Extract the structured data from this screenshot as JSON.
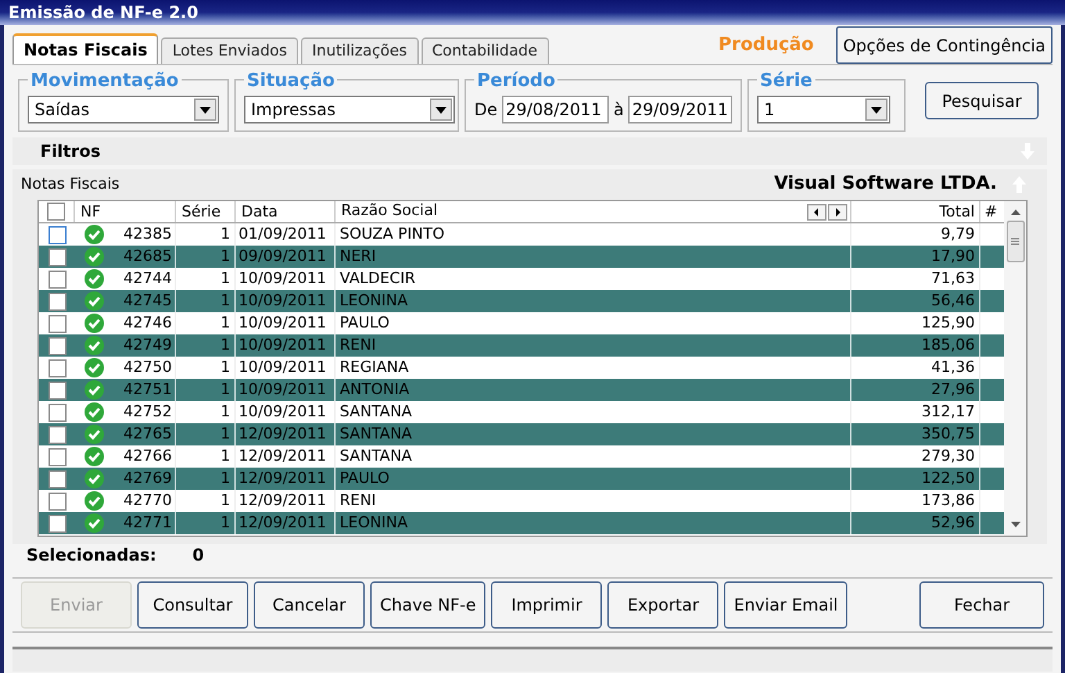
{
  "window": {
    "title": "Emissão de NF-e 2.0"
  },
  "tabs": [
    {
      "label": "Notas Fiscais",
      "selected": true
    },
    {
      "label": "Lotes Enviados",
      "selected": false
    },
    {
      "label": "Inutilizações",
      "selected": false
    },
    {
      "label": "Contabilidade",
      "selected": false
    }
  ],
  "environment": "Produção",
  "contingency_button": "Opções de Contingência",
  "filters": {
    "movimentacao": {
      "label": "Movimentação",
      "value": "Saídas"
    },
    "situacao": {
      "label": "Situação",
      "value": "Impressas"
    },
    "periodo": {
      "label": "Período",
      "from_prefix": "De",
      "from": "29/08/2011",
      "to_prefix": "à",
      "to": "29/09/2011"
    },
    "serie": {
      "label": "Série",
      "value": "1"
    },
    "search_button": "Pesquisar"
  },
  "filters_bar": {
    "title": "Filtros"
  },
  "grid": {
    "title": "Notas Fiscais",
    "company": "Visual Software LTDA.",
    "select_all_checked": false,
    "columns": [
      "NF",
      "Série",
      "Data",
      "Razão Social",
      "Total",
      "#"
    ],
    "rows": [
      {
        "nf": "42385",
        "serie": "1",
        "data": "01/09/2011",
        "razao": "SOUZA PINTO",
        "total": "9,79",
        "checked": false,
        "selected": false
      },
      {
        "nf": "42685",
        "serie": "1",
        "data": "09/09/2011",
        "razao": "NERI",
        "total": "17,90",
        "checked": false,
        "selected": true
      },
      {
        "nf": "42744",
        "serie": "1",
        "data": "10/09/2011",
        "razao": "VALDECIR",
        "total": "71,63",
        "checked": false,
        "selected": false
      },
      {
        "nf": "42745",
        "serie": "1",
        "data": "10/09/2011",
        "razao": "LEONINA",
        "total": "56,46",
        "checked": false,
        "selected": true
      },
      {
        "nf": "42746",
        "serie": "1",
        "data": "10/09/2011",
        "razao": "PAULO",
        "total": "125,90",
        "checked": false,
        "selected": false
      },
      {
        "nf": "42749",
        "serie": "1",
        "data": "10/09/2011",
        "razao": "RENI",
        "total": "185,06",
        "checked": false,
        "selected": true
      },
      {
        "nf": "42750",
        "serie": "1",
        "data": "10/09/2011",
        "razao": "REGIANA",
        "total": "41,36",
        "checked": false,
        "selected": false
      },
      {
        "nf": "42751",
        "serie": "1",
        "data": "10/09/2011",
        "razao": "ANTONIA",
        "total": "27,96",
        "checked": false,
        "selected": true
      },
      {
        "nf": "42752",
        "serie": "1",
        "data": "10/09/2011",
        "razao": "SANTANA",
        "total": "312,17",
        "checked": false,
        "selected": false
      },
      {
        "nf": "42765",
        "serie": "1",
        "data": "12/09/2011",
        "razao": "SANTANA",
        "total": "350,75",
        "checked": false,
        "selected": true
      },
      {
        "nf": "42766",
        "serie": "1",
        "data": "12/09/2011",
        "razao": "SANTANA",
        "total": "279,30",
        "checked": false,
        "selected": false
      },
      {
        "nf": "42769",
        "serie": "1",
        "data": "12/09/2011",
        "razao": "PAULO",
        "total": "122,50",
        "checked": false,
        "selected": true
      },
      {
        "nf": "42770",
        "serie": "1",
        "data": "12/09/2011",
        "razao": "RENI",
        "total": "173,86",
        "checked": false,
        "selected": false
      },
      {
        "nf": "42771",
        "serie": "1",
        "data": "12/09/2011",
        "razao": "LEONINA",
        "total": "52,96",
        "checked": false,
        "selected": true
      }
    ]
  },
  "selected_count": {
    "label": "Selecionadas:",
    "value": "0"
  },
  "buttons": [
    {
      "label": "Enviar",
      "disabled": true
    },
    {
      "label": "Consultar",
      "disabled": false
    },
    {
      "label": "Cancelar",
      "disabled": false
    },
    {
      "label": "Chave NF-e",
      "disabled": false
    },
    {
      "label": "Imprimir",
      "disabled": false
    },
    {
      "label": "Exportar",
      "disabled": false
    },
    {
      "label": "Enviar Email",
      "disabled": false
    }
  ],
  "close_button": "Fechar"
}
